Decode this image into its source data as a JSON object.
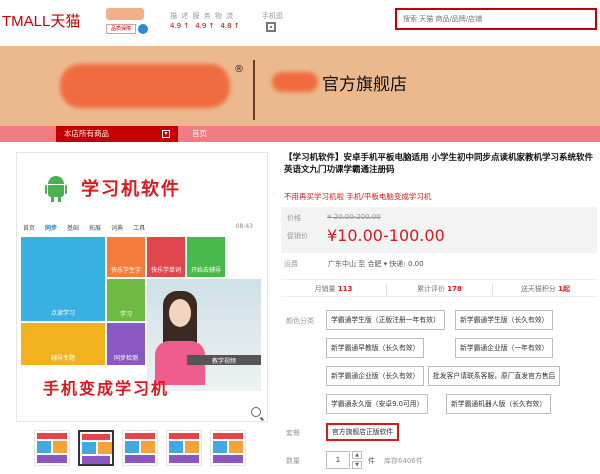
{
  "header": {
    "logo": "TMALL天猫",
    "shop_badge": "品质保障",
    "ratings_head": "描 述 服 务 物 流",
    "ratings": [
      "4.9 ↑",
      "4.9 ↑",
      "4.8 ↑"
    ],
    "mobile_label": "手机逛",
    "search_placeholder": "搜索 天猫 商品/品牌/店铺"
  },
  "banner": {
    "reg": "®",
    "title": "官方旗舰店"
  },
  "nav": {
    "all_products": "本店所有商品",
    "caret": "▾",
    "home": "首页"
  },
  "gallery": {
    "title": "学习机软件",
    "app_nav": [
      "首页",
      "同步",
      "基础",
      "拓展",
      "词典",
      "工具"
    ],
    "app_time": "08:43",
    "tiles": {
      "t1": "点读学习",
      "t2": "快乐学生字",
      "t3": "快乐学单词",
      "t4": "开始去辅导",
      "t5": "学习",
      "t6": "辅导专题",
      "t7": "同步检测",
      "t8": "教学视频"
    },
    "tagline": "手机变成学习机"
  },
  "product": {
    "title": "【学习机软件】安卓手机平板电脑适用 小学生初中同步点读机家教机学习系统软件 英语文九门功课学霸通注册码",
    "subtitle": "不用再买学习机啦 手机/平板电脑变成学习机",
    "price_label": "价格",
    "price_old": "¥ 20.00-200.00",
    "promo_label": "促销价",
    "price_new": "¥10.00-100.00",
    "ship_label": "运费",
    "ship_value": "广东中山 至 合肥 ▾ 快递: 0.00",
    "stats": [
      {
        "label": "月销量",
        "value": "113"
      },
      {
        "label": "累计评价",
        "value": "178"
      },
      {
        "label": "送天猫积分",
        "value": "1起"
      }
    ],
    "options_label": "颜色分类",
    "options": [
      "学霸通学生版（正版注册一年有效）",
      "新学霸通学生版（长久有效）",
      "新学霸通早教版（长久有效）",
      "新学霸通企业版（一年有效）",
      "新学霸通企业版（长久有效）",
      "批发客户请联系客服，原厂直发官方售后",
      "学霸通永久版（安卓9.0可用）",
      "新学霸通机器人版（长久有效）"
    ],
    "package_label": "套餐",
    "package_value": "官方旗舰店正版软件",
    "qty_label": "数量",
    "qty_value": "1",
    "qty_unit": "件",
    "stock": "库存6406件"
  }
}
